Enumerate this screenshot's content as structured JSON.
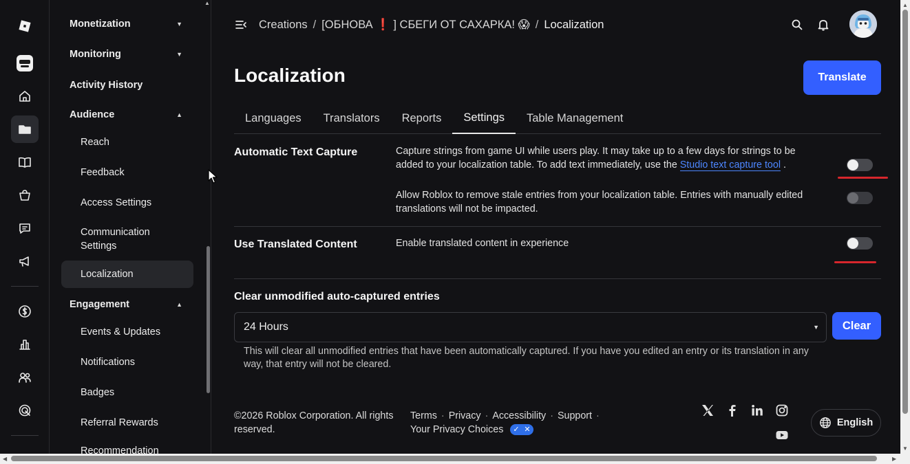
{
  "rail": {
    "items": [
      {
        "name": "roblox-logo-icon"
      },
      {
        "name": "experience-thumbnail-icon"
      },
      {
        "name": "home-icon"
      },
      {
        "name": "creations-folder-icon"
      },
      {
        "name": "docs-book-icon"
      },
      {
        "name": "store-bag-icon"
      },
      {
        "name": "forum-chat-icon"
      },
      {
        "name": "announcements-megaphone-icon"
      },
      {
        "name": "monetization-dollar-icon"
      },
      {
        "name": "analytics-chart-icon"
      },
      {
        "name": "groups-people-icon"
      },
      {
        "name": "talent-target-icon"
      }
    ]
  },
  "nav": {
    "monetization": "Monetization",
    "monitoring": "Monitoring",
    "activity_history": "Activity History",
    "audience": "Audience",
    "reach": "Reach",
    "feedback": "Feedback",
    "access_settings": "Access Settings",
    "communication_settings": "Communication Settings",
    "localization": "Localization",
    "engagement": "Engagement",
    "events_updates": "Events & Updates",
    "notifications": "Notifications",
    "badges": "Badges",
    "referral_rewards": "Referral Rewards",
    "recommendation": "Recommendation"
  },
  "breadcrumb": {
    "creations": "Creations",
    "experience": "[ОБНОВА ❗ ] СБЕГИ ОТ САХАРКА! 😱",
    "current": "Localization",
    "separator": "/"
  },
  "page": {
    "title": "Localization",
    "translate_label": "Translate"
  },
  "tabs": [
    "Languages",
    "Translators",
    "Reports",
    "Settings",
    "Table Management"
  ],
  "active_tab": "Settings",
  "settings": {
    "auto_capture": {
      "label": "Automatic Text Capture",
      "desc_1": "Capture strings from game UI while users play. It may take up to a few days for strings to be added to your localization table. To add text immediately, use the",
      "link": "Studio text capture tool",
      "desc_1_end": ".",
      "toggle_on": false,
      "desc_2": "Allow Roblox to remove stale entries from your localization table. Entries with manually edited translations will not be impacted.",
      "toggle_2_on": false
    },
    "translated_content": {
      "label": "Use Translated Content",
      "desc": "Enable translated content in experience",
      "toggle_on": false
    },
    "clear": {
      "heading": "Clear unmodified auto-captured entries",
      "selected": "24 Hours",
      "button": "Clear",
      "help": "This will clear all unmodified entries that have been automatically captured. If you have you edited an entry or its translation in any way, that entry will not be cleared."
    }
  },
  "footer": {
    "copyright": "©2026 Roblox Corporation. All rights reserved.",
    "links": [
      "Terms",
      "Privacy",
      "Accessibility",
      "Support"
    ],
    "privacy_choices": "Your Privacy Choices",
    "language": "English"
  },
  "colors": {
    "accent": "#335fff",
    "link": "#4d86ff",
    "annotation_red": "#d7262c",
    "background": "#121215"
  }
}
